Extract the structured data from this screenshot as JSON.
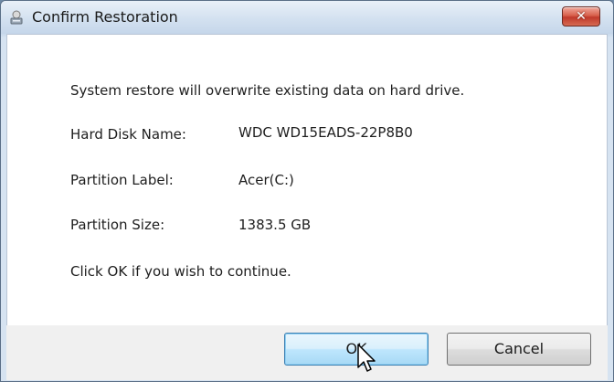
{
  "window": {
    "title": "Confirm Restoration",
    "close_label": "✕"
  },
  "message": {
    "intro": "System restore will overwrite existing data on hard drive.",
    "fields": [
      {
        "label": "Hard Disk Name:",
        "value": "WDC WD15EADS-22P8B0"
      },
      {
        "label": "Partition Label:",
        "value": "Acer(C:)"
      },
      {
        "label": "Partition Size:",
        "value": "1383.5 GB"
      }
    ],
    "prompt": "Click OK if you wish to continue."
  },
  "buttons": {
    "ok_label": "OK",
    "cancel_label": "Cancel"
  },
  "icons": {
    "app": "disk-restore-icon",
    "close": "close-icon",
    "cursor": "mouse-pointer-icon"
  },
  "colors": {
    "close_button": "#c0392b",
    "ok_focus": "#3c7fb1"
  }
}
